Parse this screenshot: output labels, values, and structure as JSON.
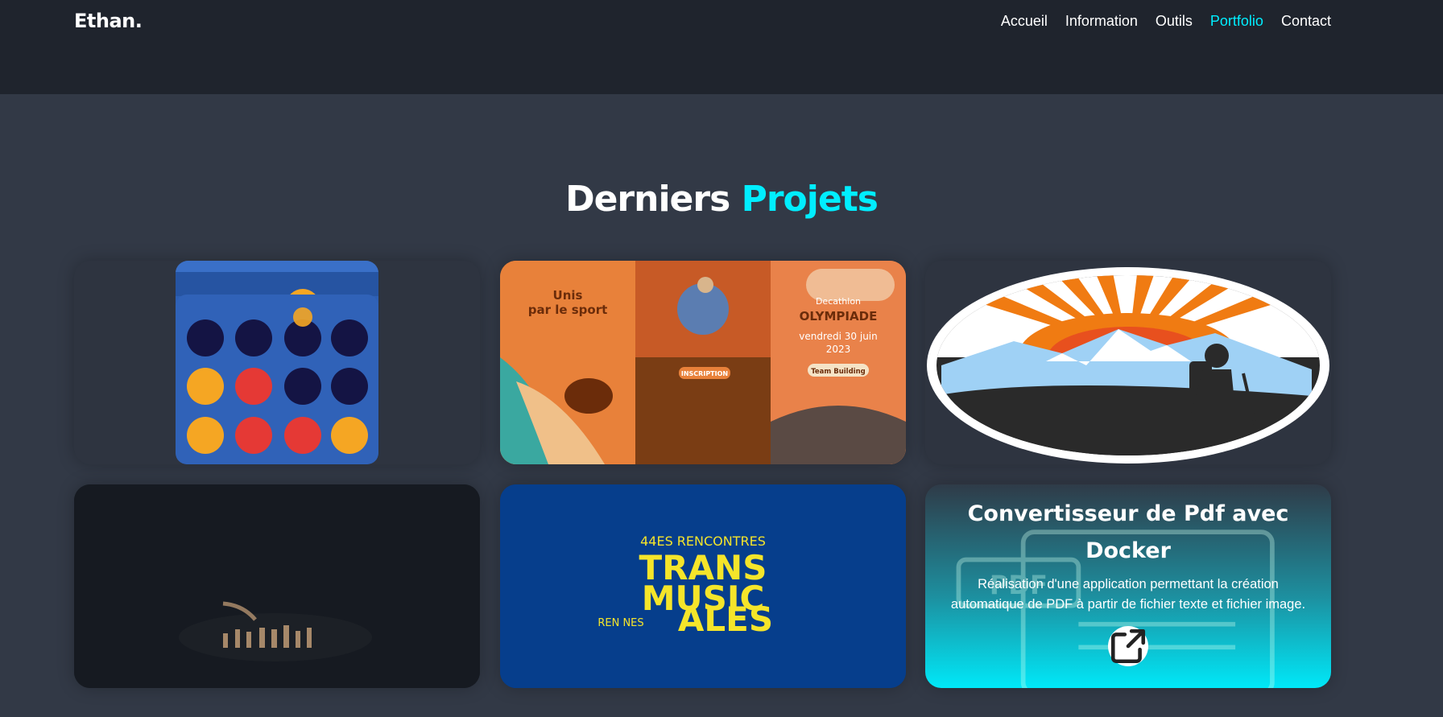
{
  "header": {
    "logo": "Ethan.",
    "nav": [
      {
        "label": "Accueil",
        "active": false
      },
      {
        "label": "Information",
        "active": false
      },
      {
        "label": "Outils",
        "active": false
      },
      {
        "label": "Portfolio",
        "active": true
      },
      {
        "label": "Contact",
        "active": false
      }
    ]
  },
  "section": {
    "title_part1": "Derniers",
    "title_part2": "Projets"
  },
  "projects": [
    {
      "image": "connect-four-board"
    },
    {
      "image": "decathlon-olympiade-brochure",
      "brochure": {
        "left_title": "Unis\npar le sport",
        "center_button": "INSCRIPTION",
        "right_brand": "Decathlon",
        "right_title": "OLYMPIADE",
        "right_date": "vendredi 30 juin",
        "right_year": "2023",
        "right_button": "Team Building"
      }
    },
    {
      "image": "hiker-sun-mountain-logo"
    },
    {
      "image": "dark-chess-pieces"
    },
    {
      "image": "trans-musicales-poster",
      "poster": {
        "line1": "44ES RENCONTRES",
        "line2": "TRANS",
        "line3": "MUSIC",
        "line4_small": "REN NES",
        "line4": "ALES"
      }
    },
    {
      "image": "pdf-converter",
      "pdf_label": "PDF",
      "title": "Convertisseur de Pdf avec Docker",
      "description": "Réalisation d'une application permettant la création automatique de PDF à partir de fichier texte et fichier image.",
      "link_icon": "external-link-icon"
    }
  ],
  "colors": {
    "accent": "#00eeff",
    "header_bg": "#1f242d",
    "page_bg": "#323946"
  }
}
